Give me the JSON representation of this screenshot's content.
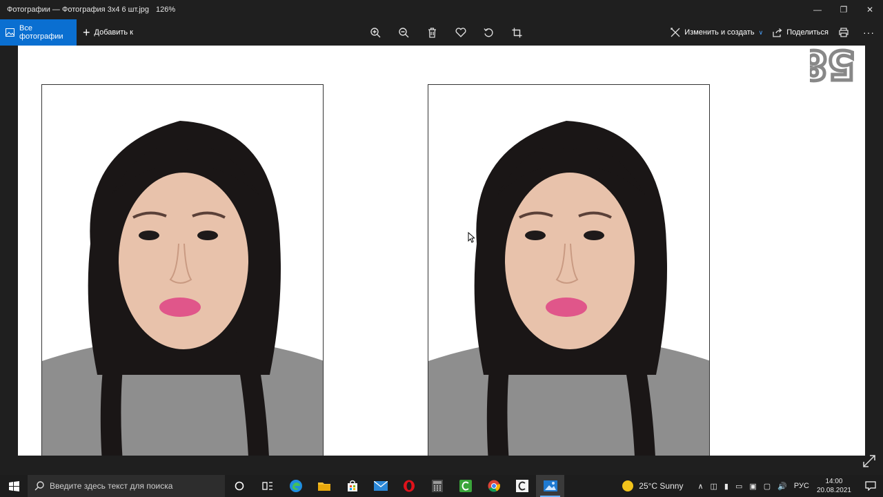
{
  "window": {
    "title": "Фотографии — Фотография 3х4 6 шт.jpg",
    "zoom": "126%",
    "minimize_icon": "minimize-icon",
    "maximize_icon": "maximize-icon",
    "close_icon": "close-icon"
  },
  "toolbar": {
    "all_photos": "Все фотографии",
    "add_to": "Добавить к",
    "edit_create": "Изменить и создать",
    "share": "Поделиться",
    "icons": [
      "zoom-in-icon",
      "zoom-out-icon",
      "delete-icon",
      "favorite-icon",
      "rotate-icon",
      "crop-icon",
      "print-icon",
      "more-icon"
    ]
  },
  "viewer": {
    "photos": [
      "passport-photo-1",
      "passport-photo-2"
    ],
    "stamp_text": "58"
  },
  "taskbar": {
    "search_placeholder": "Введите здесь текст для поиска",
    "apps": [
      "cortana",
      "task-view",
      "edge",
      "file-explorer",
      "store",
      "mail",
      "opera",
      "calculator",
      "camtasia",
      "chrome",
      "camtasia-recorder",
      "photos"
    ],
    "weather_temp": "25°C",
    "weather_desc": "Sunny",
    "language": "РУС",
    "time": "14:00",
    "date": "20.08.2021"
  },
  "colors": {
    "accent": "#0a6fd1",
    "background": "#1f1f1f",
    "taskbar": "#1d1d1d"
  }
}
